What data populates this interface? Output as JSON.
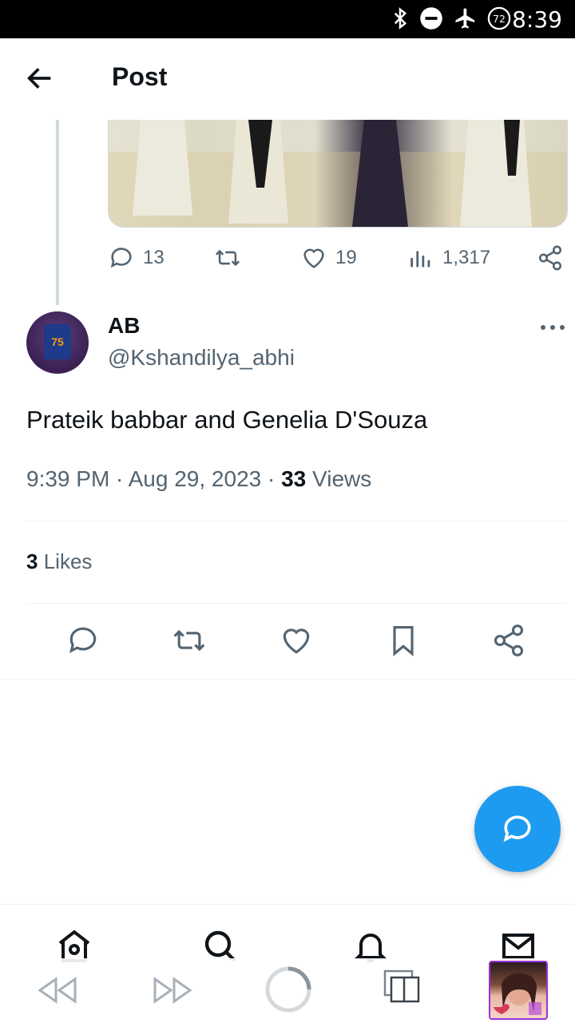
{
  "status_bar": {
    "time": "8:39",
    "battery": "72"
  },
  "header": {
    "title": "Post"
  },
  "parent_stats": {
    "replies": "13",
    "retweets": "",
    "likes": "19",
    "views": "1,317"
  },
  "tweet": {
    "author_name": "AB",
    "handle": "@Kshandilya_abhi",
    "jersey_number": "75",
    "text": "Prateik babbar and Genelia D'Souza",
    "time": "9:39 PM",
    "date": "Aug 29, 2023",
    "views_count": "33",
    "views_label": "Views",
    "likes_count": "3",
    "likes_label": "Likes"
  },
  "colors": {
    "accent": "#1d9bf0",
    "text": "#0f1419",
    "muted": "#536471",
    "border": "#eff3f4"
  },
  "icons": [
    "back-arrow-icon",
    "reply-icon",
    "retweet-icon",
    "like-icon",
    "views-icon",
    "share-icon",
    "more-icon",
    "bookmark-icon",
    "compose-icon",
    "home-icon",
    "search-icon",
    "notifications-icon",
    "messages-icon",
    "rewind-icon",
    "fast-forward-icon",
    "loading-icon",
    "tabs-icon"
  ]
}
